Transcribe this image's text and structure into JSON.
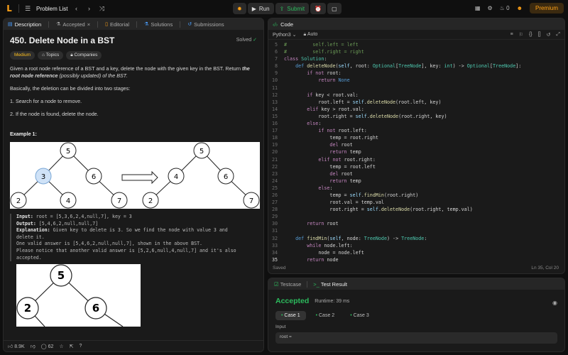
{
  "topbar": {
    "title": "Problem List",
    "run": "Run",
    "submit": "Submit",
    "streak": "0",
    "premium": "Premium"
  },
  "left": {
    "tabs": [
      "Description",
      "Accepted",
      "Editorial",
      "Solutions",
      "Submissions"
    ],
    "title": "450. Delete Node in a BST",
    "solved": "Solved",
    "chips": [
      "Medium",
      "Topics",
      "Companies"
    ],
    "p1a": "Given a root node reference of a BST and a key, delete the node with the given key in the BST. Return ",
    "p1b": "the root node reference",
    "p1c": " (possibly updated) of the BST.",
    "p2": "Basically, the deletion can be divided into two stages:",
    "p3": "1. Search for a node to remove.",
    "p4": "2. If the node is found, delete the node.",
    "example": "Example 1:",
    "input_label": "Input:",
    "input_val": " root = [5,3,6,2,4,null,7], key = 3",
    "output_label": "Output:",
    "output_val": " [5,4,6,2,null,null,7]",
    "expl_label": "Explanation:",
    "expl_val": " Given key to delete is 3. So we find the node with value 3 and",
    "expl_l2": "delete it.",
    "expl_l3": "One valid answer is [5,4,6,2,null,null,7], shown in the above BST.",
    "expl_l4": "Please notice that another valid answer is [5,2,6,null,4,null,7] and it's also",
    "expl_l5": "accepted.",
    "tree1_nodes": [
      "5",
      "3",
      "6",
      "2",
      "4",
      "7"
    ],
    "tree2_nodes": [
      "5",
      "4",
      "6",
      "2",
      "7"
    ],
    "tree3_nodes": [
      "5",
      "2",
      "6"
    ],
    "likes": "8.9K",
    "comments": "62"
  },
  "code": {
    "header": "Code",
    "lang": "Python3",
    "mode": "Auto",
    "saved": "Saved",
    "position": "Ln 35, Col 20",
    "current_line": 35
  },
  "result": {
    "tab1": "Testcase",
    "tab2": "Test Result",
    "status": "Accepted",
    "runtime": "Runtime: 39 ms",
    "cases": [
      "Case 1",
      "Case 2",
      "Case 3"
    ],
    "input_label": "Input",
    "input_val": "root ="
  }
}
